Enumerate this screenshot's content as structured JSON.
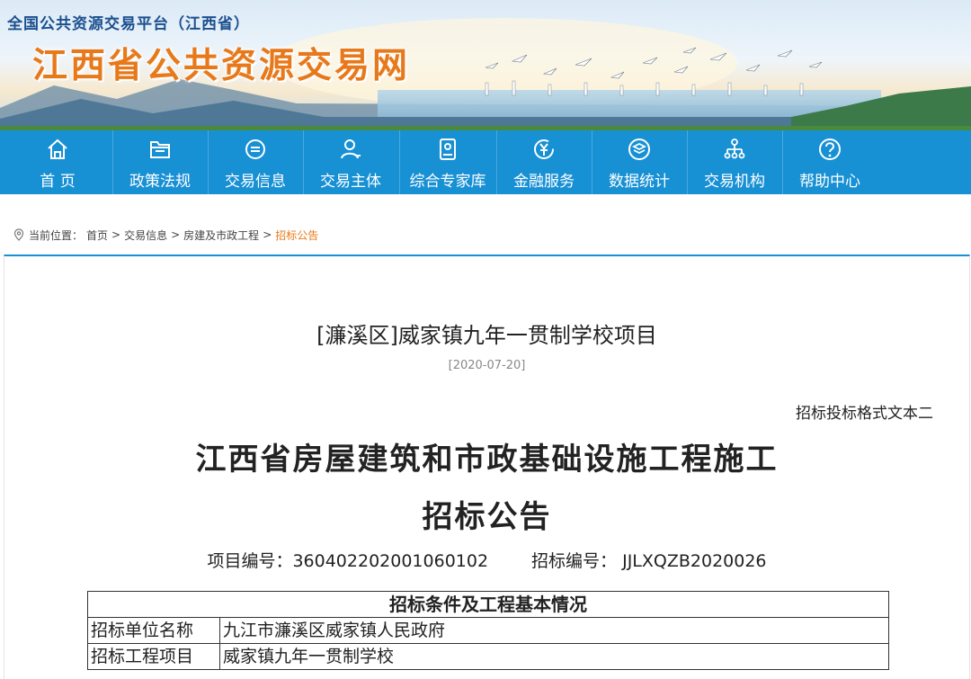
{
  "banner": {
    "platform_title": "全国公共资源交易平台（江西省）",
    "site_title": "江西省公共资源交易网"
  },
  "nav": {
    "items": [
      {
        "label": "首 页",
        "icon": "home-icon"
      },
      {
        "label": "政策法规",
        "icon": "folder-icon"
      },
      {
        "label": "交易信息",
        "icon": "list-circle-icon"
      },
      {
        "label": "交易主体",
        "icon": "user-icon"
      },
      {
        "label": "综合专家库",
        "icon": "id-card-icon"
      },
      {
        "label": "金融服务",
        "icon": "yuan-icon"
      },
      {
        "label": "数据统计",
        "icon": "layers-icon"
      },
      {
        "label": "交易机构",
        "icon": "org-chart-icon"
      },
      {
        "label": "帮助中心",
        "icon": "question-icon"
      }
    ],
    "color": "#1890d4"
  },
  "breadcrumb": {
    "prefix": "当前位置：",
    "items": [
      "首页",
      "交易信息",
      "房建及市政工程"
    ],
    "current": "招标公告",
    "separator": ">"
  },
  "article": {
    "title": "[濂溪区]威家镇九年一贯制学校项目",
    "date": "[2020-07-20]",
    "format_note": "招标投标格式文本二",
    "doc_title_line1": "江西省房屋建筑和市政基础设施工程施工",
    "doc_title_line2": "招标公告",
    "project_no": "项目编号：360402202001060102",
    "tender_no": "招标编号： JJLXQZB2020026",
    "table": {
      "header": "招标条件及工程基本情况",
      "rows": [
        {
          "key": "招标单位名称",
          "value": "九江市濂溪区威家镇人民政府"
        },
        {
          "key": "招标工程项目",
          "value": "威家镇九年一贯制学校"
        }
      ]
    }
  },
  "colors": {
    "accent": "#1890d4",
    "highlight": "#e8791b"
  }
}
